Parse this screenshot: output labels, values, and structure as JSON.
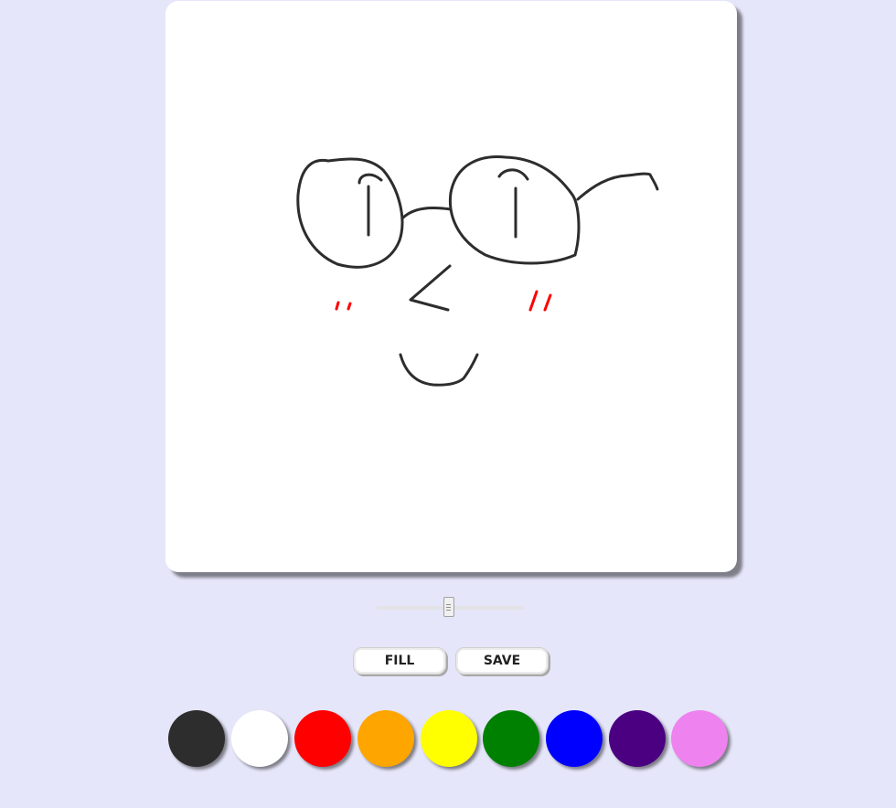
{
  "buttons": {
    "fill_label": "FILL",
    "save_label": "SAVE"
  },
  "brush_size": {
    "value_fraction": 0.49
  },
  "colors": [
    {
      "name": "black",
      "hex": "#2d2d2d"
    },
    {
      "name": "white",
      "hex": "#ffffff"
    },
    {
      "name": "red",
      "hex": "#ff0000"
    },
    {
      "name": "orange",
      "hex": "#ffa500"
    },
    {
      "name": "yellow",
      "hex": "#ffff00"
    },
    {
      "name": "green",
      "hex": "#008000"
    },
    {
      "name": "blue",
      "hex": "#0000ff"
    },
    {
      "name": "indigo",
      "hex": "#4b0082"
    },
    {
      "name": "violet",
      "hex": "#ee82ee"
    }
  ],
  "drawing": {
    "ink_color": "#2d2d2d",
    "blush_color": "#ff0000"
  }
}
